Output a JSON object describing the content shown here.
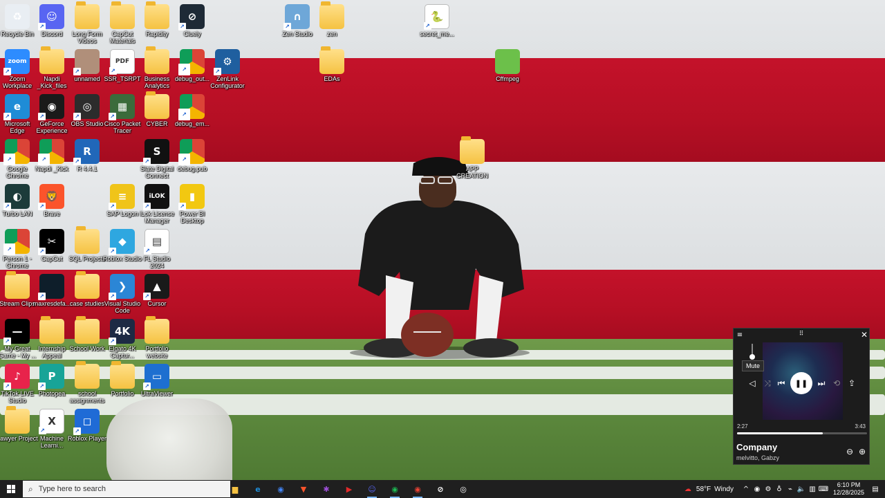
{
  "desktop": {
    "icons": [
      {
        "label": "Recycle Bin",
        "icon": "recycle-bin-icon",
        "color": "#e9eef3",
        "text": "♻"
      },
      {
        "label": "Discord",
        "icon": "discord-icon",
        "color": "#5865f2",
        "text": "☺"
      },
      {
        "label": "Long Form Videos",
        "icon": "folder-icon",
        "color": "folder",
        "text": ""
      },
      {
        "label": "CapCut Materials",
        "icon": "folder-icon",
        "color": "folder",
        "text": ""
      },
      {
        "label": "Rapidity",
        "icon": "folder-icon",
        "color": "folder",
        "text": ""
      },
      {
        "label": "Cluely",
        "icon": "cluely-icon",
        "color": "#1e2a36",
        "text": "⊘"
      },
      {
        "label": "Zen Studio",
        "icon": "zen-studio-icon",
        "color": "#6ea7d8",
        "text": "∩"
      },
      {
        "label": "zen",
        "icon": "folder-icon",
        "color": "folder",
        "text": ""
      },
      {
        "label": "secret_me...",
        "icon": "python-file-icon",
        "color": "#ffffff",
        "text": "🐍"
      },
      {
        "label": "Zoom Workplace",
        "icon": "zoom-icon",
        "color": "#2d8cff",
        "text": "zoom"
      },
      {
        "label": "Napdi _Kick_files",
        "icon": "folder-icon",
        "color": "folder",
        "text": ""
      },
      {
        "label": "unnamed",
        "icon": "image-file-icon",
        "color": "#b08f7a",
        "text": ""
      },
      {
        "label": "SSR_TSRPT",
        "icon": "pdf-icon",
        "color": "#ffffff",
        "text": "PDF"
      },
      {
        "label": "Business Analytics",
        "icon": "folder-icon",
        "color": "folder",
        "text": ""
      },
      {
        "label": "debug_out...",
        "icon": "chrome-file-icon",
        "color": "chrome",
        "text": ""
      },
      {
        "label": "ZenLink Configurator",
        "icon": "zenlink-icon",
        "color": "#1f5f9f",
        "text": "⚙"
      },
      {
        "label": "EDAs",
        "icon": "folder-icon",
        "color": "folder",
        "text": ""
      },
      {
        "label": "Cffmpeg",
        "icon": "folder-icon",
        "color": "#6cc04a",
        "text": ""
      },
      {
        "label": "Microsoft Edge",
        "icon": "edge-icon",
        "color": "#1f8cd6",
        "text": "e"
      },
      {
        "label": "GeForce Experience",
        "icon": "geforce-icon",
        "color": "#1a1a1a",
        "text": "◉"
      },
      {
        "label": "OBS Studio",
        "icon": "obs-icon",
        "color": "#2c2c2c",
        "text": "◎"
      },
      {
        "label": "Cisco Packet Tracer",
        "icon": "cisco-icon",
        "color": "#3b6b3b",
        "text": "▦"
      },
      {
        "label": "CYBER",
        "icon": "folder-icon",
        "color": "folder",
        "text": ""
      },
      {
        "label": "debug_em...",
        "icon": "chrome-file-icon",
        "color": "chrome",
        "text": ""
      },
      {
        "label": "Google Chrome",
        "icon": "chrome-icon",
        "color": "chrome",
        "text": ""
      },
      {
        "label": "Napdi _Kick",
        "icon": "chrome-file-icon",
        "color": "chrome",
        "text": ""
      },
      {
        "label": "R 4.4.1",
        "icon": "r-icon",
        "color": "#2167b9",
        "text": "R"
      },
      {
        "label": "Slate Digital Connect",
        "icon": "slate-icon",
        "color": "#111111",
        "text": "S"
      },
      {
        "label": "debug.pub",
        "icon": "chrome-file-icon",
        "color": "chrome",
        "text": ""
      },
      {
        "label": "APP CREATION",
        "icon": "folder-icon",
        "color": "folder",
        "text": ""
      },
      {
        "label": "Turbo LAN",
        "icon": "turbolan-icon",
        "color": "#1c3b3a",
        "text": "◐"
      },
      {
        "label": "Brave",
        "icon": "brave-icon",
        "color": "#fb542b",
        "text": "🦁"
      },
      {
        "label": "SAP Logon",
        "icon": "sap-icon",
        "color": "#f0c419",
        "text": "≡"
      },
      {
        "label": "iLok License Manager",
        "icon": "ilok-icon",
        "color": "#111111",
        "text": "iLOK"
      },
      {
        "label": "Power BI Desktop",
        "icon": "powerbi-icon",
        "color": "#f2c811",
        "text": "▮"
      },
      {
        "label": "Person 1 - Chrome",
        "icon": "chrome-icon",
        "color": "chrome",
        "text": ""
      },
      {
        "label": "CapCut",
        "icon": "capcut-icon",
        "color": "#000000",
        "text": "✂"
      },
      {
        "label": "SQL Projects",
        "icon": "folder-icon",
        "color": "folder",
        "text": ""
      },
      {
        "label": "Roblox Studio",
        "icon": "roblox-studio-icon",
        "color": "#2ea7e0",
        "text": "◆"
      },
      {
        "label": "FL Studio 2024",
        "icon": "fl-studio-icon",
        "color": "#ffffff",
        "text": "▤"
      },
      {
        "label": "Stream Clips",
        "icon": "folder-icon",
        "color": "folder",
        "text": ""
      },
      {
        "label": "maxresdefa...",
        "icon": "image-file-icon",
        "color": "#0e1e2a",
        "text": ""
      },
      {
        "label": "case studies",
        "icon": "folder-icon",
        "color": "folder",
        "text": ""
      },
      {
        "label": "Visual Studio Code",
        "icon": "vscode-icon",
        "color": "#2b86d6",
        "text": "❯"
      },
      {
        "label": "Cursor",
        "icon": "cursor-icon",
        "color": "#1a1a1a",
        "text": "▲"
      },
      {
        "label": "My Great Game - My ...",
        "icon": "image-file-icon",
        "color": "#000000",
        "text": "—"
      },
      {
        "label": "Internship Appeal",
        "icon": "folder-icon",
        "color": "folder",
        "text": ""
      },
      {
        "label": "School Work",
        "icon": "folder-icon",
        "color": "folder",
        "text": ""
      },
      {
        "label": "Elgato 4K Captur...",
        "icon": "elgato-icon",
        "color": "#1d2a44",
        "text": "4K"
      },
      {
        "label": "Portfolio website",
        "icon": "folder-icon",
        "color": "folder",
        "text": ""
      },
      {
        "label": "TikTok LIVE Studio",
        "icon": "tiktok-icon",
        "color": "#e8234b",
        "text": "♪"
      },
      {
        "label": "Photopea",
        "icon": "photopea-icon",
        "color": "#18a497",
        "text": "P"
      },
      {
        "label": "school assignments",
        "icon": "folder-icon",
        "color": "folder",
        "text": ""
      },
      {
        "label": "Portfolio",
        "icon": "folder-icon",
        "color": "folder",
        "text": ""
      },
      {
        "label": "UltraViewer",
        "icon": "ultraviewer-icon",
        "color": "#1e6fd0",
        "text": "▭"
      },
      {
        "label": "Lawyer Project",
        "icon": "folder-icon",
        "color": "folder",
        "text": ""
      },
      {
        "label": "Machine Learni...",
        "icon": "excel-icon",
        "color": "#ffffff",
        "text": "X"
      },
      {
        "label": "Roblox Player",
        "icon": "roblox-icon",
        "color": "#1f6bd6",
        "text": "◻"
      }
    ]
  },
  "media": {
    "tooltip": "Mute",
    "elapsed": "2:27",
    "duration": "3:43",
    "progress_fraction": 0.66,
    "title": "Company",
    "artist": "melvitto, Gabzy",
    "icons": {
      "settings": "≡",
      "drag": "⠿",
      "close": "✕",
      "mute": "◁",
      "shuffle": "⤨",
      "prev": "⏮",
      "pause": "❚❚",
      "next": "⏭",
      "repeat": "⟲",
      "share": "⇪",
      "minus": "⊖",
      "plus": "⊕"
    }
  },
  "taskbar": {
    "search_placeholder": "Type here to search",
    "apps": [
      {
        "name": "file-explorer-icon",
        "glyph": "▆",
        "color": "#f5c242",
        "active": false
      },
      {
        "name": "edge-icon",
        "glyph": "e",
        "color": "#1f8cd6",
        "active": false
      },
      {
        "name": "chrome-icon",
        "glyph": "◉",
        "color": "#4285f4",
        "active": false
      },
      {
        "name": "brave-icon",
        "glyph": "▼",
        "color": "#fb542b",
        "active": false
      },
      {
        "name": "slack-icon",
        "glyph": "✱",
        "color": "#9c4fd6",
        "active": false
      },
      {
        "name": "capcut-red-icon",
        "glyph": "▶",
        "color": "#e22a2a",
        "active": false
      },
      {
        "name": "discord-icon",
        "glyph": "☺",
        "color": "#5865f2",
        "active": true
      },
      {
        "name": "spotify-icon",
        "glyph": "◉",
        "color": "#1db954",
        "active": true
      },
      {
        "name": "chrome-profile-icon",
        "glyph": "◉",
        "color": "#ea4335",
        "active": true
      },
      {
        "name": "cluely-icon",
        "glyph": "⊘",
        "color": "#ffffff",
        "active": false
      },
      {
        "name": "obs-icon",
        "glyph": "◎",
        "color": "#ffffff",
        "active": false
      }
    ],
    "weather_temp": "58°F",
    "weather_desc": "Windy",
    "time": "6:10 PM",
    "date": "12/28/2025"
  }
}
